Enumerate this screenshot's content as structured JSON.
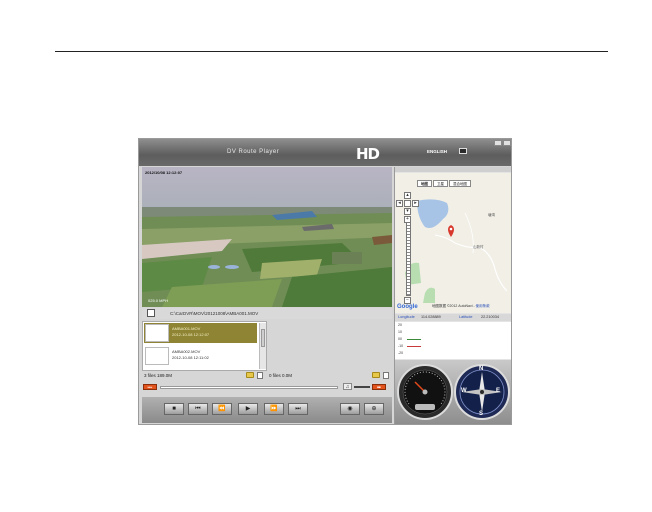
{
  "app": {
    "title": "DV Route Player",
    "hd_logo": "HD",
    "language": "ENGLISH"
  },
  "video": {
    "timestamp_overlay": "2012/10/08 12:12:07",
    "speed_overlay": "025.0 MPH"
  },
  "file_path": "C:\\CarDVR\\MOV\\20121008\\AMBA001.MOV",
  "file_list": [
    {
      "name": "AMBA001.MOV",
      "date": "2012-10-08 12:12:07",
      "selected": true
    },
    {
      "name": "AMBA002.MOV",
      "date": "2012-10-08 12:11:02",
      "selected": false
    }
  ],
  "status": {
    "left_files": "3 files 189.0M",
    "right_files": "0 files 0.0M"
  },
  "progress": {
    "left_label": "▸▸▸",
    "right_label": "■■",
    "position": 0.0
  },
  "controls": {
    "stop": "■",
    "prev": "⏮",
    "rewind": "⏪",
    "play": "▶",
    "forward": "⏩",
    "next": "⏭",
    "snapshot": "◉",
    "zoom": "⊕"
  },
  "map": {
    "tabs": [
      "地图",
      "卫星",
      "混合地图"
    ],
    "active_tab": 0,
    "google_logo": "Google",
    "copyright": "地图数据 ©2012 AutoNavi -",
    "copyright_link": "使用条款",
    "labels": [
      "塘湾",
      "山新村"
    ]
  },
  "coordinates": {
    "longitude_label": "Longitude",
    "longitude_value": "114.028889",
    "latitude_label": "Latitude",
    "latitude_value": "22.210034"
  },
  "sensor": {
    "ticks": [
      "20",
      "10",
      "00",
      "-10",
      "-20"
    ]
  },
  "compass": {
    "n": "N",
    "s": "S",
    "e": "E",
    "w": "W"
  },
  "colors": {
    "selected_row": "#8f8433",
    "accent_orange": "#e2541c",
    "coord_label": "#2a4fb8"
  }
}
